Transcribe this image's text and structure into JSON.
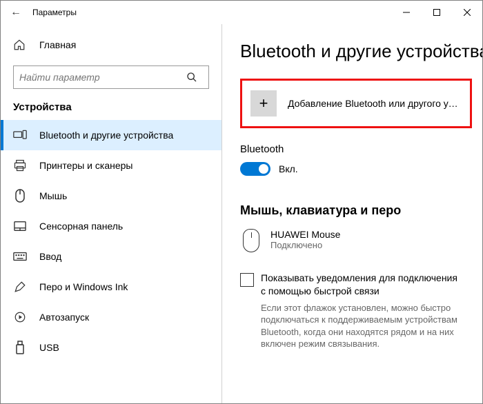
{
  "titlebar": {
    "back": "←",
    "title": "Параметры"
  },
  "sidebar": {
    "home": "Главная",
    "search_placeholder": "Найти параметр",
    "section": "Устройства",
    "items": [
      {
        "label": "Bluetooth и другие устройства"
      },
      {
        "label": "Принтеры и сканеры"
      },
      {
        "label": "Мышь"
      },
      {
        "label": "Сенсорная панель"
      },
      {
        "label": "Ввод"
      },
      {
        "label": "Перо и Windows Ink"
      },
      {
        "label": "Автозапуск"
      },
      {
        "label": "USB"
      }
    ]
  },
  "main": {
    "heading": "Bluetooth и другие устройства",
    "add_device": "Добавление Bluetooth или другого устройс…",
    "bt_section": "Bluetooth",
    "bt_on": "Вкл.",
    "devices_heading": "Мышь, клавиатура и перо",
    "device": {
      "name": "HUAWEI  Mouse",
      "status": "Подключено"
    },
    "checkbox_label": "Показывать уведомления для подключения с помощью быстрой связи",
    "checkbox_hint": "Если этот флажок установлен, можно быстро подключаться к поддерживаемым устройствам Bluetooth, когда они находятся рядом и на них включен режим связывания."
  }
}
